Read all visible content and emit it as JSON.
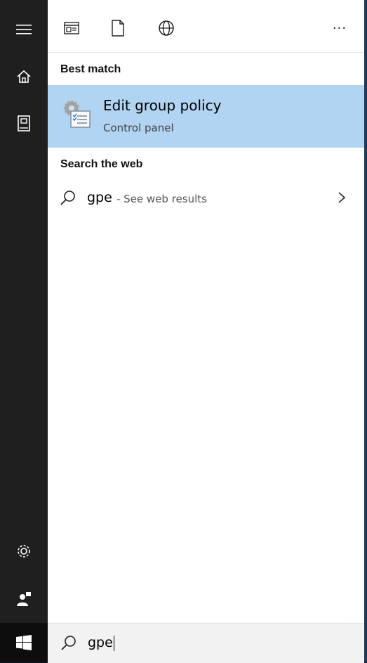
{
  "rail": {
    "items": [
      {
        "icon": "hamburger-menu-icon"
      },
      {
        "icon": "home-icon"
      },
      {
        "icon": "notebook-icon"
      },
      {
        "icon": "settings-gear-icon"
      },
      {
        "icon": "feedback-person-icon"
      },
      {
        "icon": "windows-start-icon"
      }
    ]
  },
  "topbar": {
    "icons": [
      "apps-icon",
      "documents-icon",
      "web-icon",
      "more-options-icon"
    ],
    "more_label": "···"
  },
  "best_match": {
    "heading": "Best match",
    "title": "Edit group policy",
    "subtitle": "Control panel",
    "icon": "group-policy-icon"
  },
  "web": {
    "heading": "Search the web",
    "query": "gpe",
    "suffix": "- See web results"
  },
  "search": {
    "value": "gpe"
  },
  "colors": {
    "rail_bg": "#1f1f1f",
    "highlight": "#b0d4f1",
    "search_bg": "#f2f2f2"
  }
}
